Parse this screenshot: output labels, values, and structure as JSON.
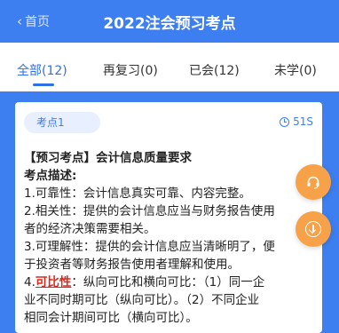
{
  "header": {
    "back_label": "首页",
    "title": "2022注会预习考点"
  },
  "tabs": [
    {
      "label": "全部(12)",
      "active": true
    },
    {
      "label": "再复习(0)",
      "active": false
    },
    {
      "label": "已会(12)",
      "active": false
    },
    {
      "label": "未学(0)",
      "active": false
    }
  ],
  "card": {
    "badge": "考点1",
    "timer": "51S",
    "heading": "【预习考点】会计信息质量要求",
    "subheading": "考点描述:",
    "lines": [
      "1.可靠性：会计信息真实可靠、内容完整。",
      "2.相关性：提供的会计信息应当与财务报告使用",
      "者的经济决策需要相关。",
      "3.可理解性：提供的会计信息应当清晰明了，便",
      "于投资者等财务报告使用者理解和使用。"
    ],
    "highlight_prefix": "4.",
    "highlight_term": "可比性",
    "highlight_rest": "：纵向可比和横向可比：（1）同一企",
    "tail_lines": [
      "业不同时期可比（纵向可比）。（2）不同企业",
      "相同会计期间可比（横向可比）。"
    ]
  },
  "colors": {
    "primary": "#3d7ef0",
    "accent": "#f7a248",
    "highlight": "#e0261a"
  },
  "icons": {
    "fab_top": "headset-icon",
    "fab_bottom": "arrow-down-circle-icon",
    "timer": "clock-icon",
    "back": "chevron-left-icon"
  }
}
